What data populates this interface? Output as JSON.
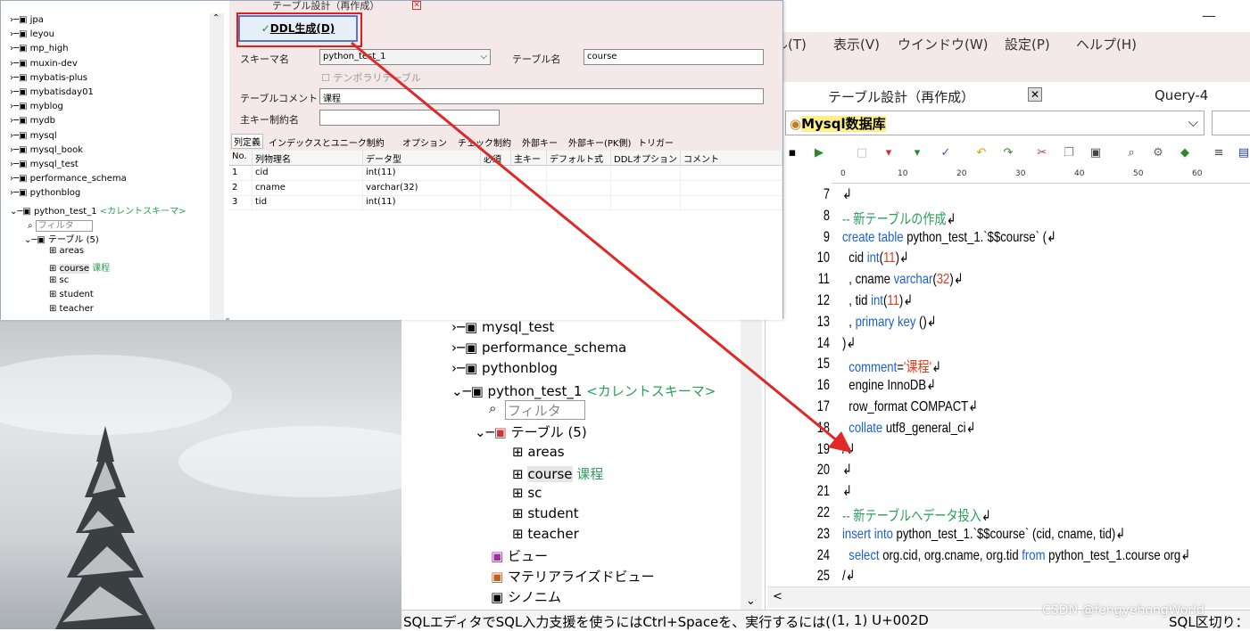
{
  "main_window": {
    "menus": [
      "ル(T)",
      "表示(V)",
      "ウインドウ(W)",
      "設定(P)",
      "ヘルプ(H)"
    ],
    "tabs": [
      "テーブル設計（再作成）",
      "Query-4"
    ],
    "connection": "Mysql数据库",
    "ruler_ticks": [
      "0",
      "10",
      "20",
      "30",
      "40",
      "50",
      "60"
    ],
    "status_text": "SQLエディタでSQL入力支援を使うにはCtrl+Spaceを、実行するには(",
    "status_pos": "(1, 1) U+002D",
    "status_right": "SQL区切り："
  },
  "editor": {
    "lines": [
      {
        "n": "7",
        "html": "<span>↲</span>"
      },
      {
        "n": "8",
        "html": "<span class='cm'>-- 新テーブルの作成</span>↲"
      },
      {
        "n": "9",
        "html": "<span class='kw'>create table</span> python_test_1.`$$course` (↲"
      },
      {
        "n": "10",
        "html": "  cid <span class='kw'>int</span>(<span class='nm'>11</span>)↲"
      },
      {
        "n": "11",
        "html": "  , cname <span class='kw'>varchar</span>(<span class='nm'>32</span>)↲"
      },
      {
        "n": "12",
        "html": "  , tid <span class='kw'>int</span>(<span class='nm'>11</span>)↲"
      },
      {
        "n": "13",
        "html": "  , <span class='kw'>primary key</span> ()↲"
      },
      {
        "n": "14",
        "html": ")↲"
      },
      {
        "n": "15",
        "html": "  <span class='kw'>comment</span>=<span class='st'>'课程'</span>↲"
      },
      {
        "n": "16",
        "html": "  engine InnoDB↲"
      },
      {
        "n": "17",
        "html": "  row_format COMPACT↲"
      },
      {
        "n": "18",
        "html": "  <span class='kw'>collate</span> utf8_general_ci↲"
      },
      {
        "n": "19",
        "html": "/↲"
      },
      {
        "n": "20",
        "html": "↲"
      },
      {
        "n": "21",
        "html": "↲"
      },
      {
        "n": "22",
        "html": "<span class='cm'>-- 新テーブルへデータ投入</span>↲"
      },
      {
        "n": "23",
        "html": "<span class='kw'>insert into</span> python_test_1.`$$course` (cid, cname, tid)↲"
      },
      {
        "n": "24",
        "html": "  <span class='kw'>select</span> org.cid, org.cname, org.tid <span class='kw'>from</span> python_test_1.course org↲"
      },
      {
        "n": "25",
        "html": "/↲"
      }
    ]
  },
  "main_tree": {
    "items": [
      "mysql_test",
      "performance_schema",
      "pythonblog",
      "python_test_1",
      "<カレントスキーマ>",
      "フィルタ",
      "テーブル (5)",
      "areas",
      "course",
      "课程",
      "sc",
      "student",
      "teacher",
      "ビュー",
      "マテリアライズドビュー",
      "シノニム"
    ]
  },
  "overlay": {
    "title": "テーブル設計（再作成）",
    "ddl_button": "DDL生成(D)",
    "schema_label": "スキーマ名",
    "schema_value": "python_test_1",
    "table_label": "テーブル名",
    "table_value": "course",
    "temp_label": "テンポラリテーブル",
    "comment_label": "テーブルコメント",
    "comment_value": "课程",
    "pk_label": "主キー制約名",
    "tabs": [
      "列定義",
      "インデックスとユニーク制約",
      "オプション",
      "チェック制約",
      "外部キー",
      "外部キー(PK側)",
      "トリガー"
    ],
    "grid_headers": [
      "No.",
      "列物理名",
      "データ型",
      "必須",
      "主キー",
      "デフォルト式",
      "DDLオプション",
      "コメント"
    ],
    "grid_rows": [
      [
        "1",
        "cid",
        "int(11)"
      ],
      [
        "2",
        "cname",
        "varchar(32)"
      ],
      [
        "3",
        "tid",
        "int(11)"
      ]
    ],
    "tree": [
      "jpa",
      "leyou",
      "mp_high",
      "muxin-dev",
      "mybatis-plus",
      "mybatisday01",
      "myblog",
      "mydb",
      "mysql",
      "mysql_book",
      "mysql_test",
      "performance_schema",
      "pythonblog",
      "python_test_1",
      "<カレントスキーマ>",
      "フィルタ",
      "テーブル (5)",
      "areas",
      "course",
      "课程",
      "sc",
      "student",
      "teacher"
    ]
  },
  "watermark": "CSDN @fengyehongWorld"
}
